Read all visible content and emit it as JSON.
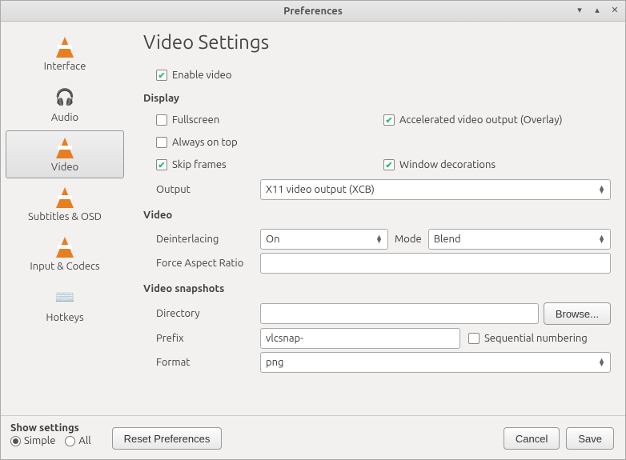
{
  "titlebar": {
    "title": "Preferences"
  },
  "sidebar": {
    "items": [
      {
        "label": "Interface"
      },
      {
        "label": "Audio"
      },
      {
        "label": "Video"
      },
      {
        "label": "Subtitles & OSD"
      },
      {
        "label": "Input & Codecs"
      },
      {
        "label": "Hotkeys"
      }
    ]
  },
  "page": {
    "title": "Video Settings",
    "enable_video": "Enable video",
    "display": {
      "heading": "Display",
      "fullscreen": "Fullscreen",
      "accelerated": "Accelerated video output (Overlay)",
      "always_on_top": "Always on top",
      "skip_frames": "Skip frames",
      "window_decorations": "Window decorations",
      "output_label": "Output",
      "output_value": "X11 video output (XCB)"
    },
    "video": {
      "heading": "Video",
      "deinterlacing_label": "Deinterlacing",
      "deinterlacing_value": "On",
      "mode_label": "Mode",
      "mode_value": "Blend",
      "force_aspect_label": "Force Aspect Ratio",
      "force_aspect_value": ""
    },
    "snapshots": {
      "heading": "Video snapshots",
      "directory_label": "Directory",
      "directory_value": "",
      "browse": "Browse...",
      "prefix_label": "Prefix",
      "prefix_value": "vlcsnap-",
      "sequential": "Sequential numbering",
      "format_label": "Format",
      "format_value": "png"
    }
  },
  "show_settings": {
    "heading": "Show settings",
    "simple": "Simple",
    "all": "All"
  },
  "footer": {
    "reset": "Reset Preferences",
    "cancel": "Cancel",
    "save": "Save"
  },
  "checked": {
    "enable_video": true,
    "fullscreen": false,
    "accelerated": true,
    "always_on_top": false,
    "skip_frames": true,
    "window_decorations": true,
    "sequential": false,
    "simple": true,
    "all": false
  }
}
